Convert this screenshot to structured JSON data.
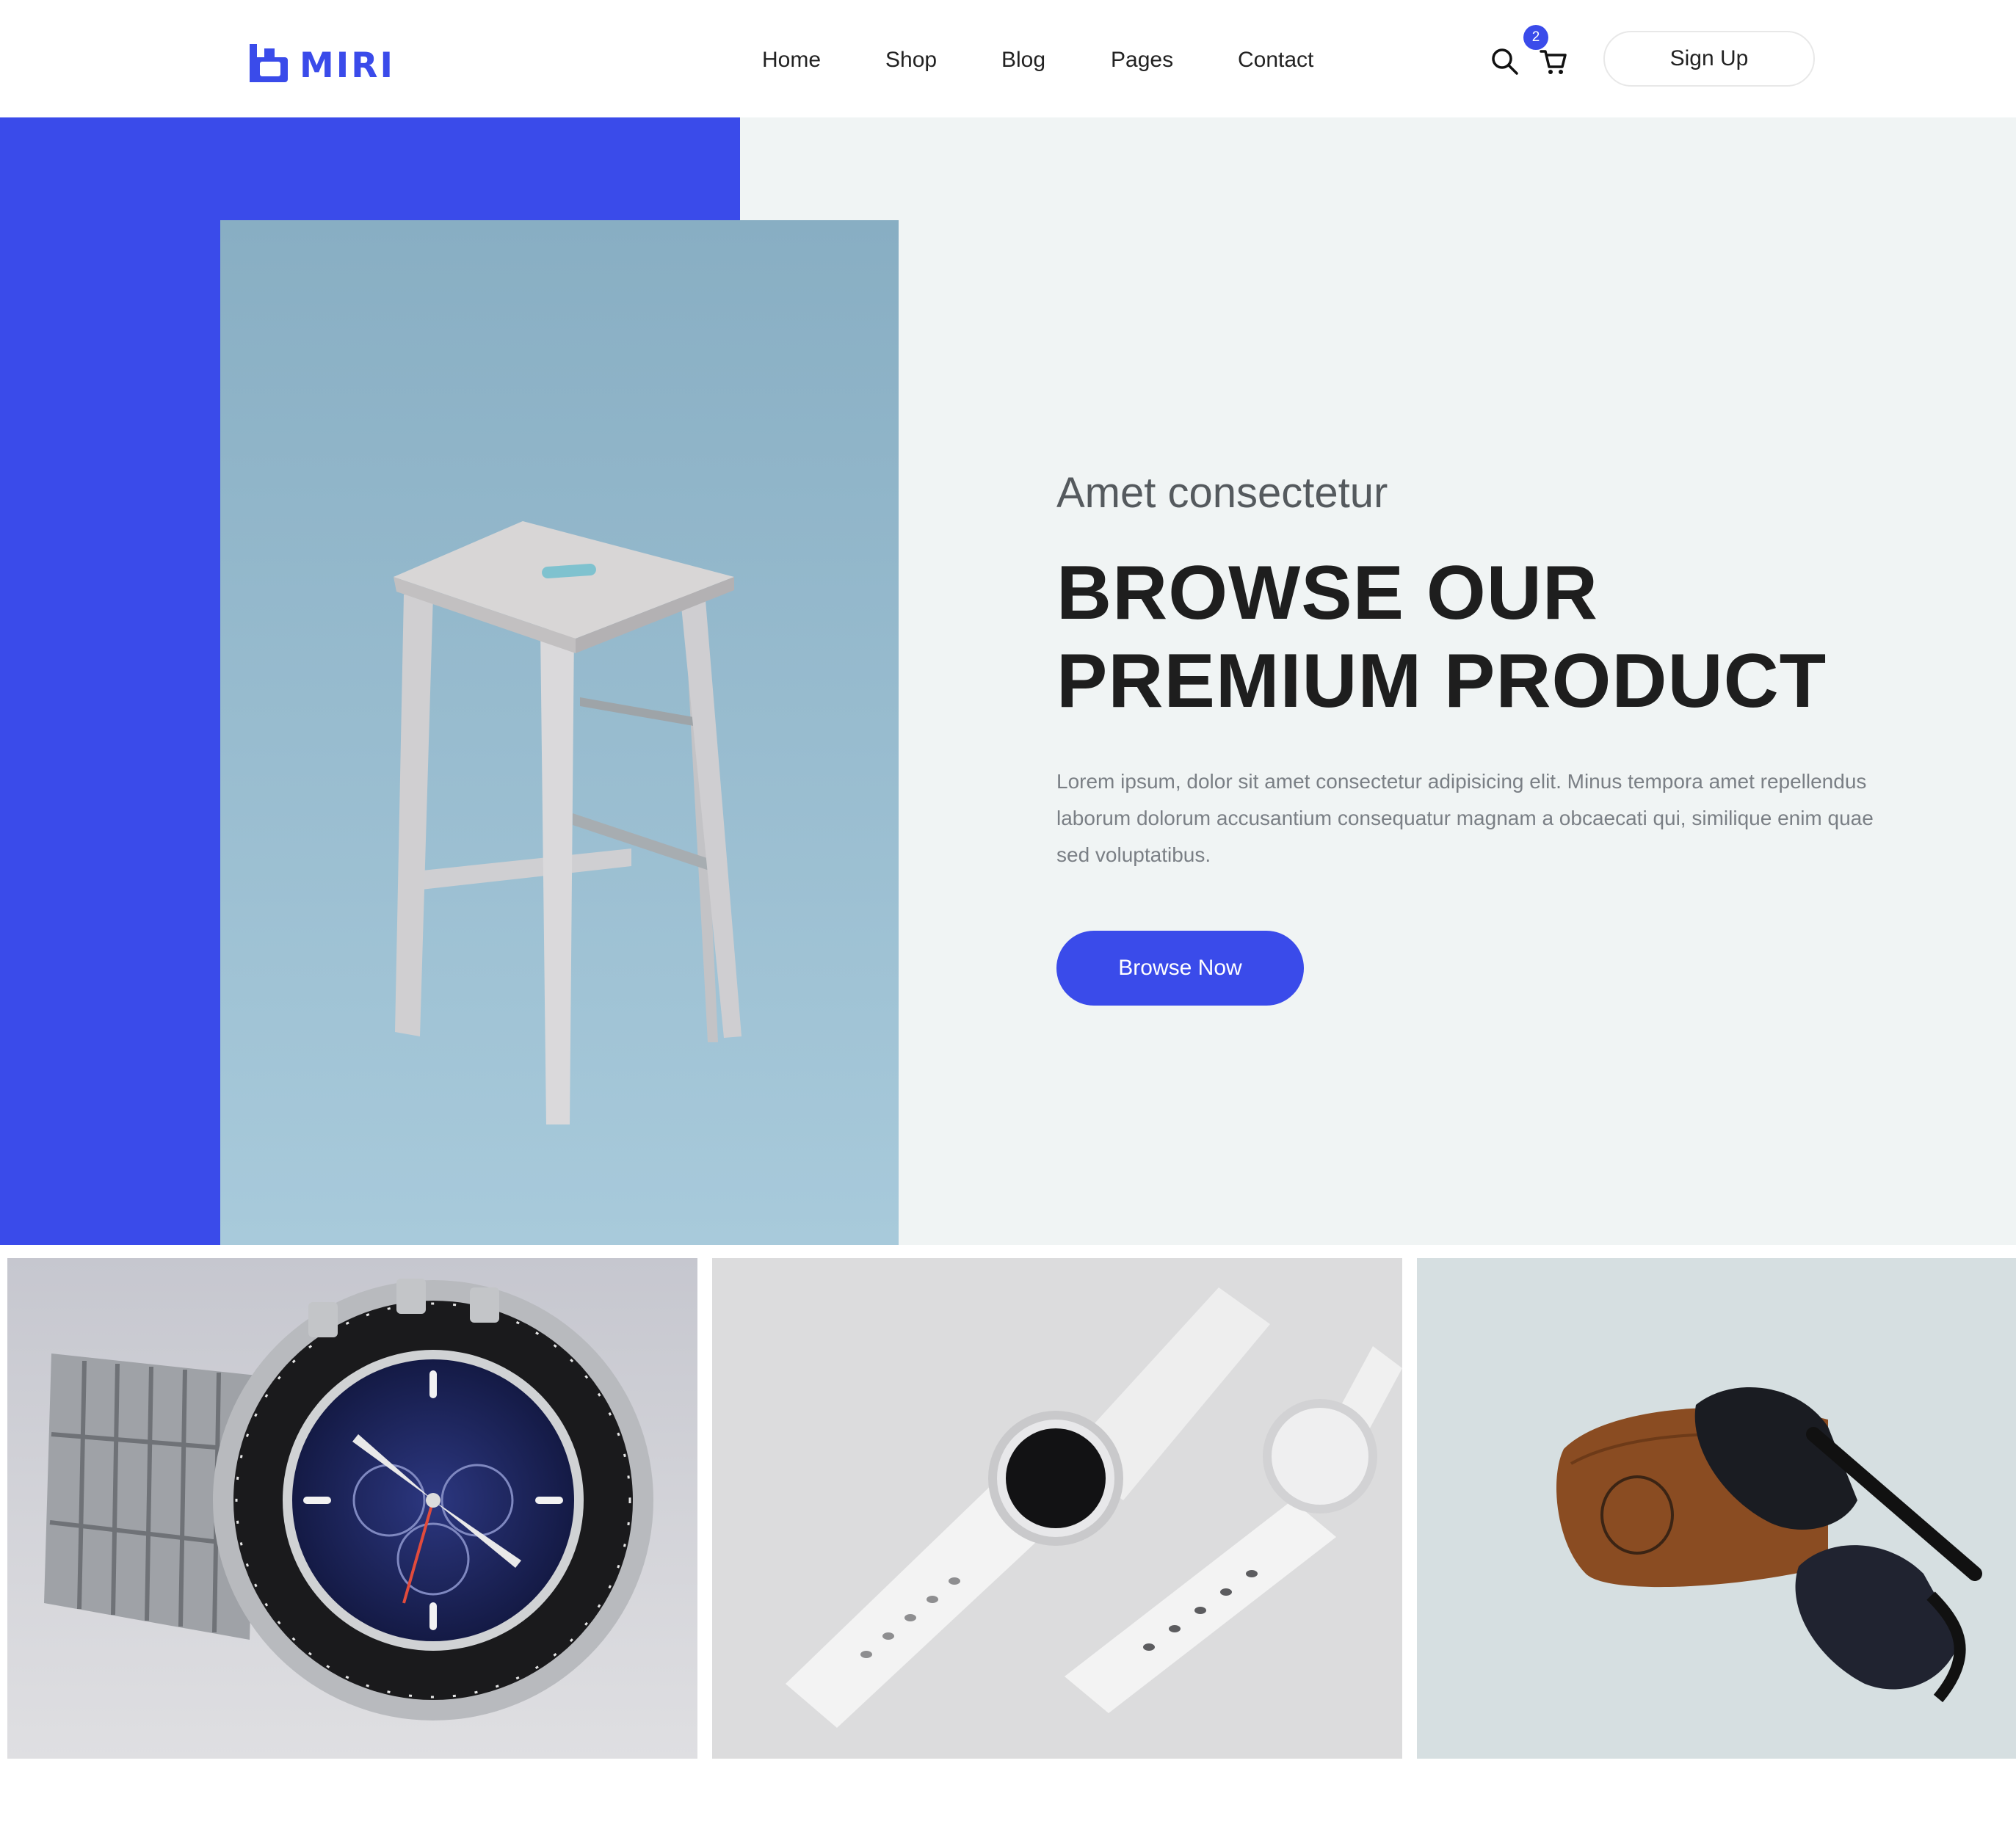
{
  "brand": {
    "logo_text": "MIRI",
    "accent_color": "#3a4bea"
  },
  "nav": {
    "items": [
      {
        "label": "Home"
      },
      {
        "label": "Shop"
      },
      {
        "label": "Blog"
      },
      {
        "label": "Pages"
      },
      {
        "label": "Contact"
      }
    ]
  },
  "header": {
    "search_icon": "search-icon",
    "cart_icon": "cart-icon",
    "cart_count": "2",
    "signup_label": "Sign Up"
  },
  "hero": {
    "eyebrow": "Amet consectetur",
    "title_line1": "BROWSE OUR",
    "title_line2": "PREMIUM PRODUCT",
    "text": "Lorem ipsum, dolor sit amet consectetur adipisicing elit. Minus tempora amet repellendus laborum dolorum accusantium consequatur magnam a obcaecati qui, similique enim quae sed voluptatibus.",
    "cta_label": "Browse Now",
    "image": "wooden-stool-photo"
  },
  "products": {
    "tiles": [
      {
        "image": "chronograph-watch-photo"
      },
      {
        "image": "white-smartwatches-photo"
      },
      {
        "image": "sunglasses-photo"
      }
    ]
  }
}
